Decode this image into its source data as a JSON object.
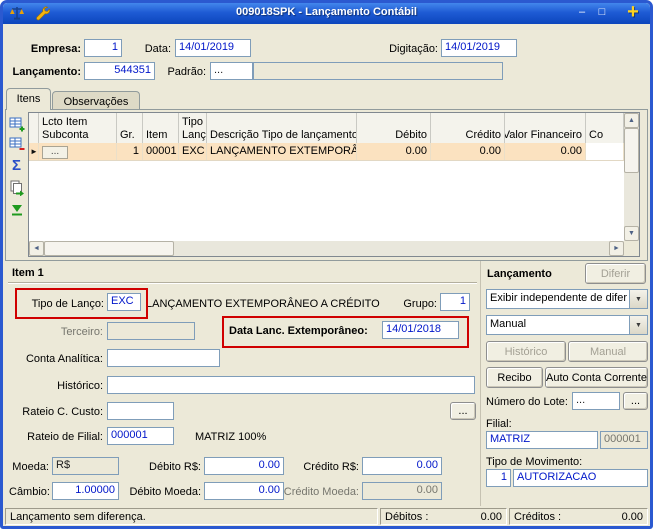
{
  "titlebar": {
    "title": "009018SPK - Lançamento Contábil",
    "minimize_glyph": "–",
    "maximize_glyph": "□",
    "plus_glyph": "+"
  },
  "form": {
    "empresa_label": "Empresa:",
    "empresa": "1",
    "data_label": "Data:",
    "data": "14/01/2019",
    "digitacao_label": "Digitação:",
    "digitacao": "14/01/2019",
    "lancamento_label": "Lançamento:",
    "lancamento": "544351",
    "padrao_label": "Padrão:",
    "padrao_lookup": "...",
    "padrao": ""
  },
  "tabs": {
    "itens": "Itens",
    "observacoes": "Observações"
  },
  "grid": {
    "headers": [
      {
        "l1": "Lcto Item",
        "l2": "Subconta"
      },
      {
        "l1": "",
        "l2": "Gr."
      },
      {
        "l1": "",
        "l2": "Item"
      },
      {
        "l1": "Tipo",
        "l2": "Lanç."
      },
      {
        "l1": "",
        "l2": "Descrição Tipo de lançamento"
      },
      {
        "l1": "",
        "l2": "Débito"
      },
      {
        "l1": "",
        "l2": "Crédito"
      },
      {
        "l1": "",
        "l2": "Valor Financeiro"
      },
      {
        "l1": "",
        "l2": "Co"
      }
    ],
    "row": {
      "lcto": "...",
      "gr": "1",
      "item": "00001",
      "tipo": "EXC",
      "descricao": "LANÇAMENTO EXTEMPORÂNE",
      "debito": "0.00",
      "credito": "0.00",
      "valor": "0.00",
      "co": ""
    }
  },
  "item": {
    "title": "Item 1",
    "tipo_lancto_label": "Tipo de Lanço:",
    "tipo_lancto": "EXC",
    "tipo_lancto_desc": "LANÇAMENTO EXTEMPORÂNEO A CRÉDITO",
    "grupo_label": "Grupo:",
    "grupo": "1",
    "terceiro_label": "Terceiro:",
    "terceiro": "",
    "data_extemp_label": "Data Lanc. Extemporâneo:",
    "data_extemp": "14/01/2018",
    "conta_analitica_label": "Conta Analítica:",
    "conta_analitica": "",
    "historico_label": "Histórico:",
    "historico": "",
    "rateio_custo_label": "Rateio C. Custo:",
    "rateio_custo": "",
    "rateio_custo_lookup": "...",
    "rateio_filial_label": "Rateio de Filial:",
    "rateio_filial": "000001",
    "rateio_filial_desc": "MATRIZ 100%",
    "moeda_label": "Moeda:",
    "moeda": "R$",
    "debito_rs_label": "Débito R$:",
    "debito_rs": "0.00",
    "credito_rs_label": "Crédito R$:",
    "credito_rs": "0.00",
    "cambio_label": "Câmbio:",
    "cambio": "1.00000",
    "debito_moeda_label": "Débito Moeda:",
    "debito_moeda": "0.00",
    "credito_moeda_label": "Crédito Moeda:",
    "credito_moeda": "0.00"
  },
  "lanc": {
    "title": "Lançamento",
    "diferir": "Diferir",
    "combo_exibir": "Exibir independente de difer",
    "combo_tipo": "Manual",
    "historico_btn": "Histórico",
    "manual_btn": "Manual",
    "recibo_btn": "Recibo",
    "auto_cc_btn": "Auto Conta Corrente",
    "lote_label": "Número do Lote:",
    "lote": "...",
    "lote_lookup": "...",
    "filial_label": "Filial:",
    "filial": "MATRIZ",
    "filial_code": "000001",
    "tipo_mov_label": "Tipo de Movimento:",
    "tipo_mov_code": "1",
    "tipo_mov": "AUTORIZACAO"
  },
  "status": {
    "message": "Lançamento sem diferença.",
    "debitos_label": "Débitos :",
    "debitos": "0.00",
    "creditos_label": "Créditos :",
    "creditos": "0.00"
  }
}
